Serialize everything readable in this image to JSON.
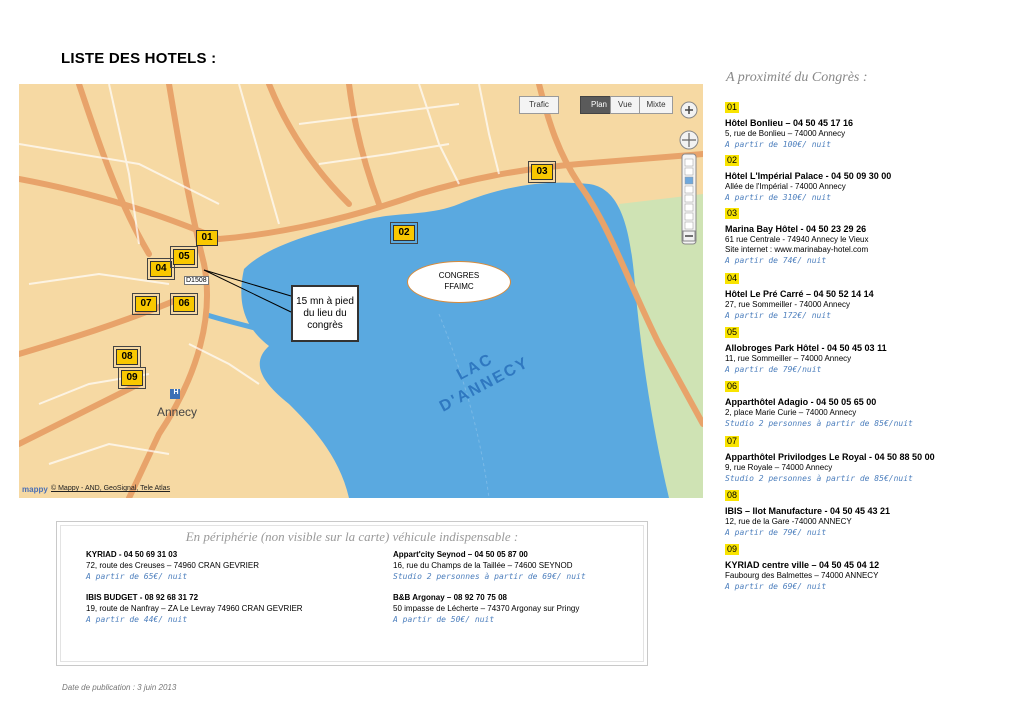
{
  "page": {
    "title": "LISTE DES HOTELS :",
    "publication_date": "Date de publication : 3 juin 2013"
  },
  "map": {
    "map_types": [
      "Trafic",
      "Plan",
      "Vue",
      "Mixte"
    ],
    "active_map_type": "Plan",
    "callout_text": "15 mn à pied du lieu du congrès",
    "congres_label_line1": "CONGRES",
    "congres_label_line2": "FFAIMC",
    "lake_label_line1": "LAC",
    "lake_label_line2": "D'ANNECY",
    "town_label": "Annecy",
    "road_label": "D1508",
    "hospital_label": "H",
    "logo": "mappy",
    "copyright": "© Mappy - AND, GeoSignal, Tele Atlas",
    "markers": [
      "01",
      "02",
      "03",
      "04",
      "05",
      "06",
      "07",
      "08",
      "09"
    ],
    "colors": {
      "land": "#f6d9a3",
      "lake": "#5aa9e0",
      "road": "#e8a36a",
      "marker": "#f9c800",
      "park": "#c8dfb0"
    },
    "icons": [
      "zoom-in-icon",
      "pan-icon",
      "zoom-slider-icon",
      "zoom-out-icon"
    ]
  },
  "right_column": {
    "title": "A proximité du Congrès :",
    "hotels": [
      {
        "num": "01",
        "name": "Hôtel Bonlieu – 04 50 45 17 16",
        "addr": "5, rue de Bonlieu – 74000 Annecy",
        "addr2": "",
        "price": "A partir de 100€/ nuit"
      },
      {
        "num": "02",
        "name": "Hôtel L'Impérial Palace - 04 50 09 30 00",
        "addr": "Allée de l'Impérial - 74000 Annecy",
        "addr2": "",
        "price": "A partir de 310€/ nuit"
      },
      {
        "num": "03",
        "name": "Marina Bay Hôtel - 04 50 23 29 26",
        "addr": "61 rue Centrale - 74940 Annecy le Vieux",
        "addr2": "Site internet : www.marinabay-hotel.com",
        "price": "A partir de 74€/ nuit"
      },
      {
        "num": "04",
        "name": "Hôtel Le Pré Carré – 04 50 52 14 14",
        "addr": "27, rue Sommeiller - 74000 Annecy",
        "addr2": "",
        "price": "A partir de 172€/ nuit"
      },
      {
        "num": "05",
        "name": "Allobroges Park Hôtel - 04 50 45 03 11",
        "addr": "11, rue Sommeiller – 74000 Annecy",
        "addr2": "",
        "price": "A partir de 79€/nuit"
      },
      {
        "num": "06",
        "name": "Apparthôtel Adagio - 04 50 05 65 00",
        "addr": "2, place Marie Curie – 74000 Annecy",
        "addr2": "",
        "price": "Studio 2 personnes à partir de 85€/nuit"
      },
      {
        "num": "07",
        "name": "Apparthôtel Privilodges Le Royal - 04 50 88 50 00",
        "addr": "9, rue Royale – 74000 Annecy",
        "addr2": "",
        "price": "Studio 2 personnes à partir de 85€/nuit"
      },
      {
        "num": "08",
        "name": "IBIS – Ilot Manufacture - 04 50 45 43 21",
        "addr": "12, rue de la Gare  -74000 ANNECY",
        "addr2": "",
        "price": "A partir de 79€/ nuit"
      },
      {
        "num": "09",
        "name": "KYRIAD centre ville – 04 50 45 04 12",
        "addr": "Faubourg des Balmettes – 74000 ANNECY",
        "addr2": "",
        "price": "A partir de 69€/ nuit"
      }
    ]
  },
  "periphery": {
    "title": "En périphérie (non visible sur la carte) véhicule indispensable :",
    "entries": [
      {
        "name": "KYRIAD - 04 50 69 31 03",
        "addr": "72, route des Creuses – 74960 CRAN GEVRIER",
        "price": "A partir de 65€/ nuit"
      },
      {
        "name": "Appart'city Seynod – 04 50 05 87 00",
        "addr": "16, rue du Champs de la Taillée – 74600 SEYNOD",
        "price": "Studio 2 personnes à partir de 69€/ nuit"
      },
      {
        "name": "IBIS BUDGET - 08 92 68 31 72",
        "addr": "19, route de Nanfray – ZA Le Levray 74960 CRAN GEVRIER",
        "price": "A partir de 44€/ nuit"
      },
      {
        "name": "B&B Argonay – 08 92 70 75 08",
        "addr": "50 impasse de Lécherte – 74370 Argonay sur Pringy",
        "price": "A partir de 50€/ nuit"
      }
    ]
  }
}
